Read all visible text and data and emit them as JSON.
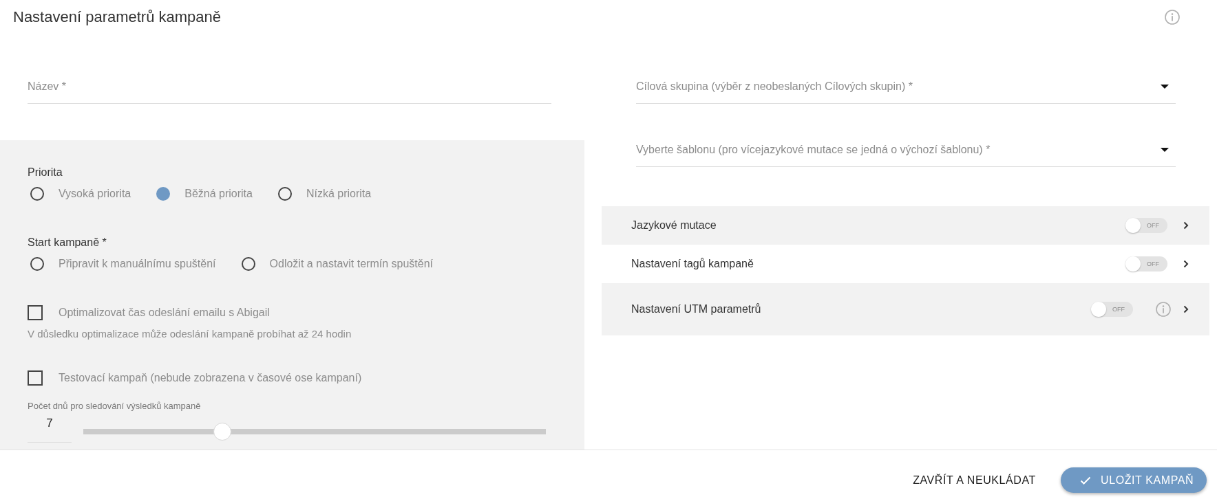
{
  "dialog": {
    "title": "Nastavení parametrů kampaně"
  },
  "name_field": {
    "placeholder": "Název *"
  },
  "target_group_select": {
    "placeholder": "Cílová skupina (výběr z neobeslaných Cílových skupin) *"
  },
  "template_select": {
    "placeholder": "Vyberte šablonu (pro vícejazykové mutace se jedná o výchozí šablonu) *"
  },
  "priority": {
    "label": "Priorita",
    "options": [
      {
        "label": "Vysoká priorita",
        "selected": false
      },
      {
        "label": "Běžná priorita",
        "selected": true
      },
      {
        "label": "Nízká priorita",
        "selected": false
      }
    ]
  },
  "campaign_start": {
    "label": "Start kampaně *",
    "options": [
      {
        "label": "Připravit k manuálnímu spuštění",
        "selected": false
      },
      {
        "label": "Odložit a nastavit termín spuštění",
        "selected": false
      }
    ]
  },
  "options": [
    {
      "label": "Optimalizovat čas odeslání emailu s Abigail",
      "checked": false,
      "hint": "V důsledku optimalizace může odeslání kampaně probíhat až 24 hodin"
    },
    {
      "label": "Testovací kampaň (nebude zobrazena v časové ose kampaní)",
      "checked": false
    }
  ],
  "tracking_days": {
    "label": "Počet dnů pro sledování výsledků kampaně",
    "value": "7",
    "level": 0.3
  },
  "sections": [
    {
      "label": "Jazykové mutace",
      "toggle": {
        "on": false,
        "text": "OFF"
      },
      "info": false
    },
    {
      "label": "Nastavení tagů kampaně",
      "toggle": {
        "on": false,
        "text": "OFF"
      },
      "info": false
    },
    {
      "label": "Nastavení UTM parametrů",
      "toggle": {
        "on": false,
        "text": "OFF"
      },
      "info": true
    }
  ],
  "footer": {
    "buttons": [
      {
        "label": "ZAVŘÍT A NEUKLÁDAT",
        "kind": "text"
      },
      {
        "label": "ULOŽIT KAMPAŇ",
        "kind": "primary"
      }
    ]
  }
}
